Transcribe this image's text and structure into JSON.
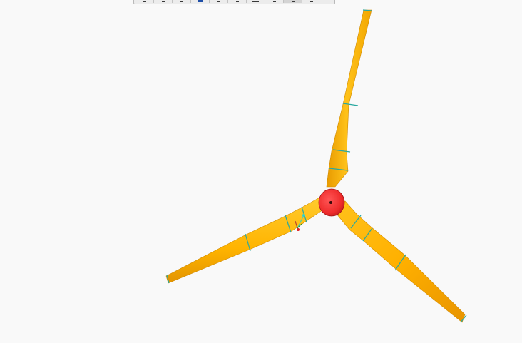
{
  "app": {
    "view": "3d-model-viewport"
  },
  "toolbar": {
    "buttons": [
      {
        "icon": "rotate-icon"
      },
      {
        "icon": "pan-icon"
      },
      {
        "icon": "zoom-icon"
      },
      {
        "icon": "shaded-view-icon"
      },
      {
        "icon": "view-orient-icon"
      },
      {
        "icon": "section-icon"
      },
      {
        "icon": "display-style-icon"
      },
      {
        "icon": "datum-display-icon"
      },
      {
        "icon": "spin-center-icon"
      },
      {
        "icon": "annotation-icon"
      }
    ]
  },
  "model": {
    "blade_color": "#FFB400",
    "hub_color": "#EE2B2B",
    "section_line_color": "#2AA8A0"
  }
}
